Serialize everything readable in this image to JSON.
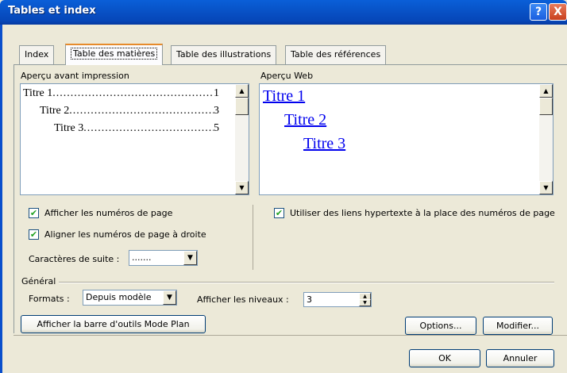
{
  "window": {
    "title": "Tables et index",
    "help_glyph": "?",
    "close_glyph": "X"
  },
  "tabs": [
    {
      "label": "Index",
      "active": false
    },
    {
      "label": "Table des matières",
      "active": true
    },
    {
      "label": "Table des illustrations",
      "active": false
    },
    {
      "label": "Table des références",
      "active": false
    }
  ],
  "print_preview": {
    "label": "Aperçu avant impression",
    "entries": [
      {
        "title": "Titre 1",
        "page": "1"
      },
      {
        "title": "Titre 2",
        "page": "3"
      },
      {
        "title": "Titre 3",
        "page": "5"
      }
    ]
  },
  "web_preview": {
    "label": "Aperçu Web",
    "entries": [
      "Titre 1",
      "Titre 2",
      "Titre 3"
    ]
  },
  "options": {
    "show_page_numbers": {
      "label": "Afficher les numéros de page",
      "checked": true
    },
    "align_right": {
      "label": "Aligner les numéros de page à droite",
      "checked": true
    },
    "use_hyperlinks": {
      "label": "Utiliser des liens hypertexte à la place des numéros de page",
      "checked": true
    },
    "tab_leader": {
      "label": "Caractères de suite :",
      "value": "......."
    }
  },
  "general": {
    "heading": "Général",
    "formats_label": "Formats :",
    "formats_value": "Depuis modèle",
    "levels_label": "Afficher les niveaux :",
    "levels_value": "3"
  },
  "buttons": {
    "outline_toolbar": "Afficher la barre d'outils Mode Plan",
    "options": "Options...",
    "modify": "Modifier...",
    "ok": "OK",
    "cancel": "Annuler"
  }
}
